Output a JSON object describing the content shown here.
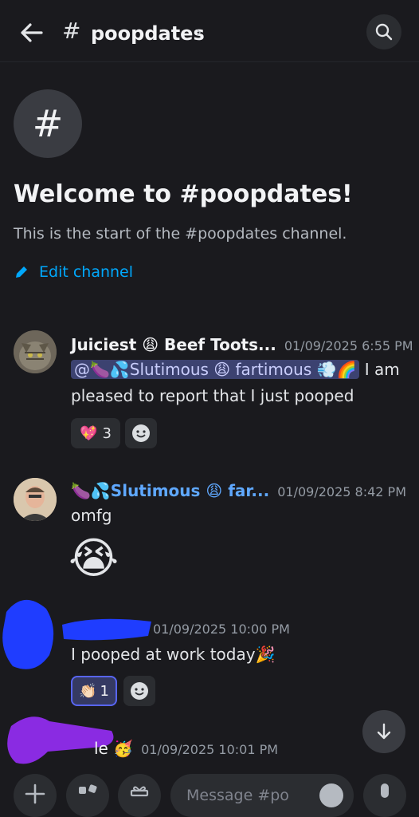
{
  "header": {
    "channel": "poopdates",
    "hash": "#",
    "chevron": "›"
  },
  "welcome": {
    "title": "Welcome to #poopdates!",
    "subtitle": "This is the start of the #poopdates channel.",
    "edit_label": "Edit channel"
  },
  "messages": [
    {
      "author": "Juiciest 😩 Beef Toots...",
      "timestamp": "01/09/2025 6:55 PM",
      "mention": "@🍆💦Slutimous 😩 fartimous 💨🌈",
      "text": " I am pleased to report that I just pooped",
      "reactions": [
        {
          "emoji": "💖",
          "count": "3"
        }
      ]
    },
    {
      "author": "🍆💦Slutimous 😩 far...",
      "timestamp": "01/09/2025 8:42 PM",
      "text": "omfg",
      "emoji": "😭"
    },
    {
      "timestamp": "01/09/2025 10:00 PM",
      "text": "I pooped at work today🎉",
      "reactions": [
        {
          "emoji": "👏🏻",
          "count": "1"
        }
      ]
    },
    {
      "author_fragment": "le 🥳",
      "timestamp": "01/09/2025 10:01 PM"
    }
  ],
  "composer": {
    "placeholder": "Message #po"
  },
  "colors": {
    "background": "#1a1a1e",
    "accent_link": "#00a8fc",
    "author_blue": "#5fa8ff",
    "mention_bg": "#3c4270"
  }
}
